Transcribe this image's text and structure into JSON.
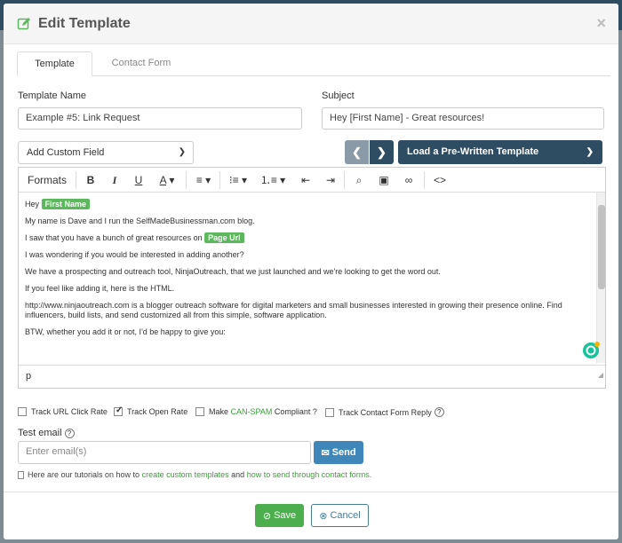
{
  "modal": {
    "title": "Edit Template",
    "close": "×"
  },
  "tabs": [
    {
      "label": "Template",
      "active": true
    },
    {
      "label": "Contact Form",
      "active": false
    }
  ],
  "template_name": {
    "label": "Template Name",
    "value": "Example #5: Link Request"
  },
  "subject": {
    "label": "Subject",
    "value": "Hey [First Name] - Great resources!"
  },
  "custom_field": {
    "value": "Add Custom Field"
  },
  "load_template": {
    "label": "Load a Pre-Written Template"
  },
  "toolbar": {
    "formats": "Formats"
  },
  "editor": {
    "greeting": "Hey",
    "tag_first_name": "First Name",
    "line1": "My name is Dave and I run the SelfMadeBusinessman.com blog.",
    "line2": "I saw that you have a bunch of great resources on",
    "tag_page_url": "Page Url",
    "line3": "I was wondering if you would be interested in adding another?",
    "line4": "We have a prospecting and outreach tool, NinjaOutreach, that we just launched and we're looking to get the word out.",
    "line5": "If you feel like adding it, here is the HTML.",
    "line6": "http://www.ninjaoutreach.com is a blogger outreach software for digital marketers and small businesses interested in growing their presence online. Find influencers, build lists, and send customized all from this simple, software application.",
    "line7": "BTW, whether you add it or not, I'd be happy to give you:",
    "status": "p"
  },
  "options": {
    "track_url": "Track URL Click Rate",
    "track_open": "Track Open Rate",
    "make": "Make",
    "can_spam": "CAN-SPAM",
    "compliant": "Compliant ?",
    "track_contact": "Track Contact Form Reply"
  },
  "test_email": {
    "label": "Test email",
    "placeholder": "Enter email(s)",
    "send": "Send"
  },
  "tutorial": {
    "prefix": "Here are our tutorials on how to",
    "link1": "create custom templates",
    "middle": "and",
    "link2": "how to send through contact forms."
  },
  "footer": {
    "save": "Save",
    "cancel": "Cancel"
  },
  "colors": {
    "accent_green": "#5cb85c",
    "navy": "#2f4d62",
    "send_blue": "#3f87b8"
  }
}
